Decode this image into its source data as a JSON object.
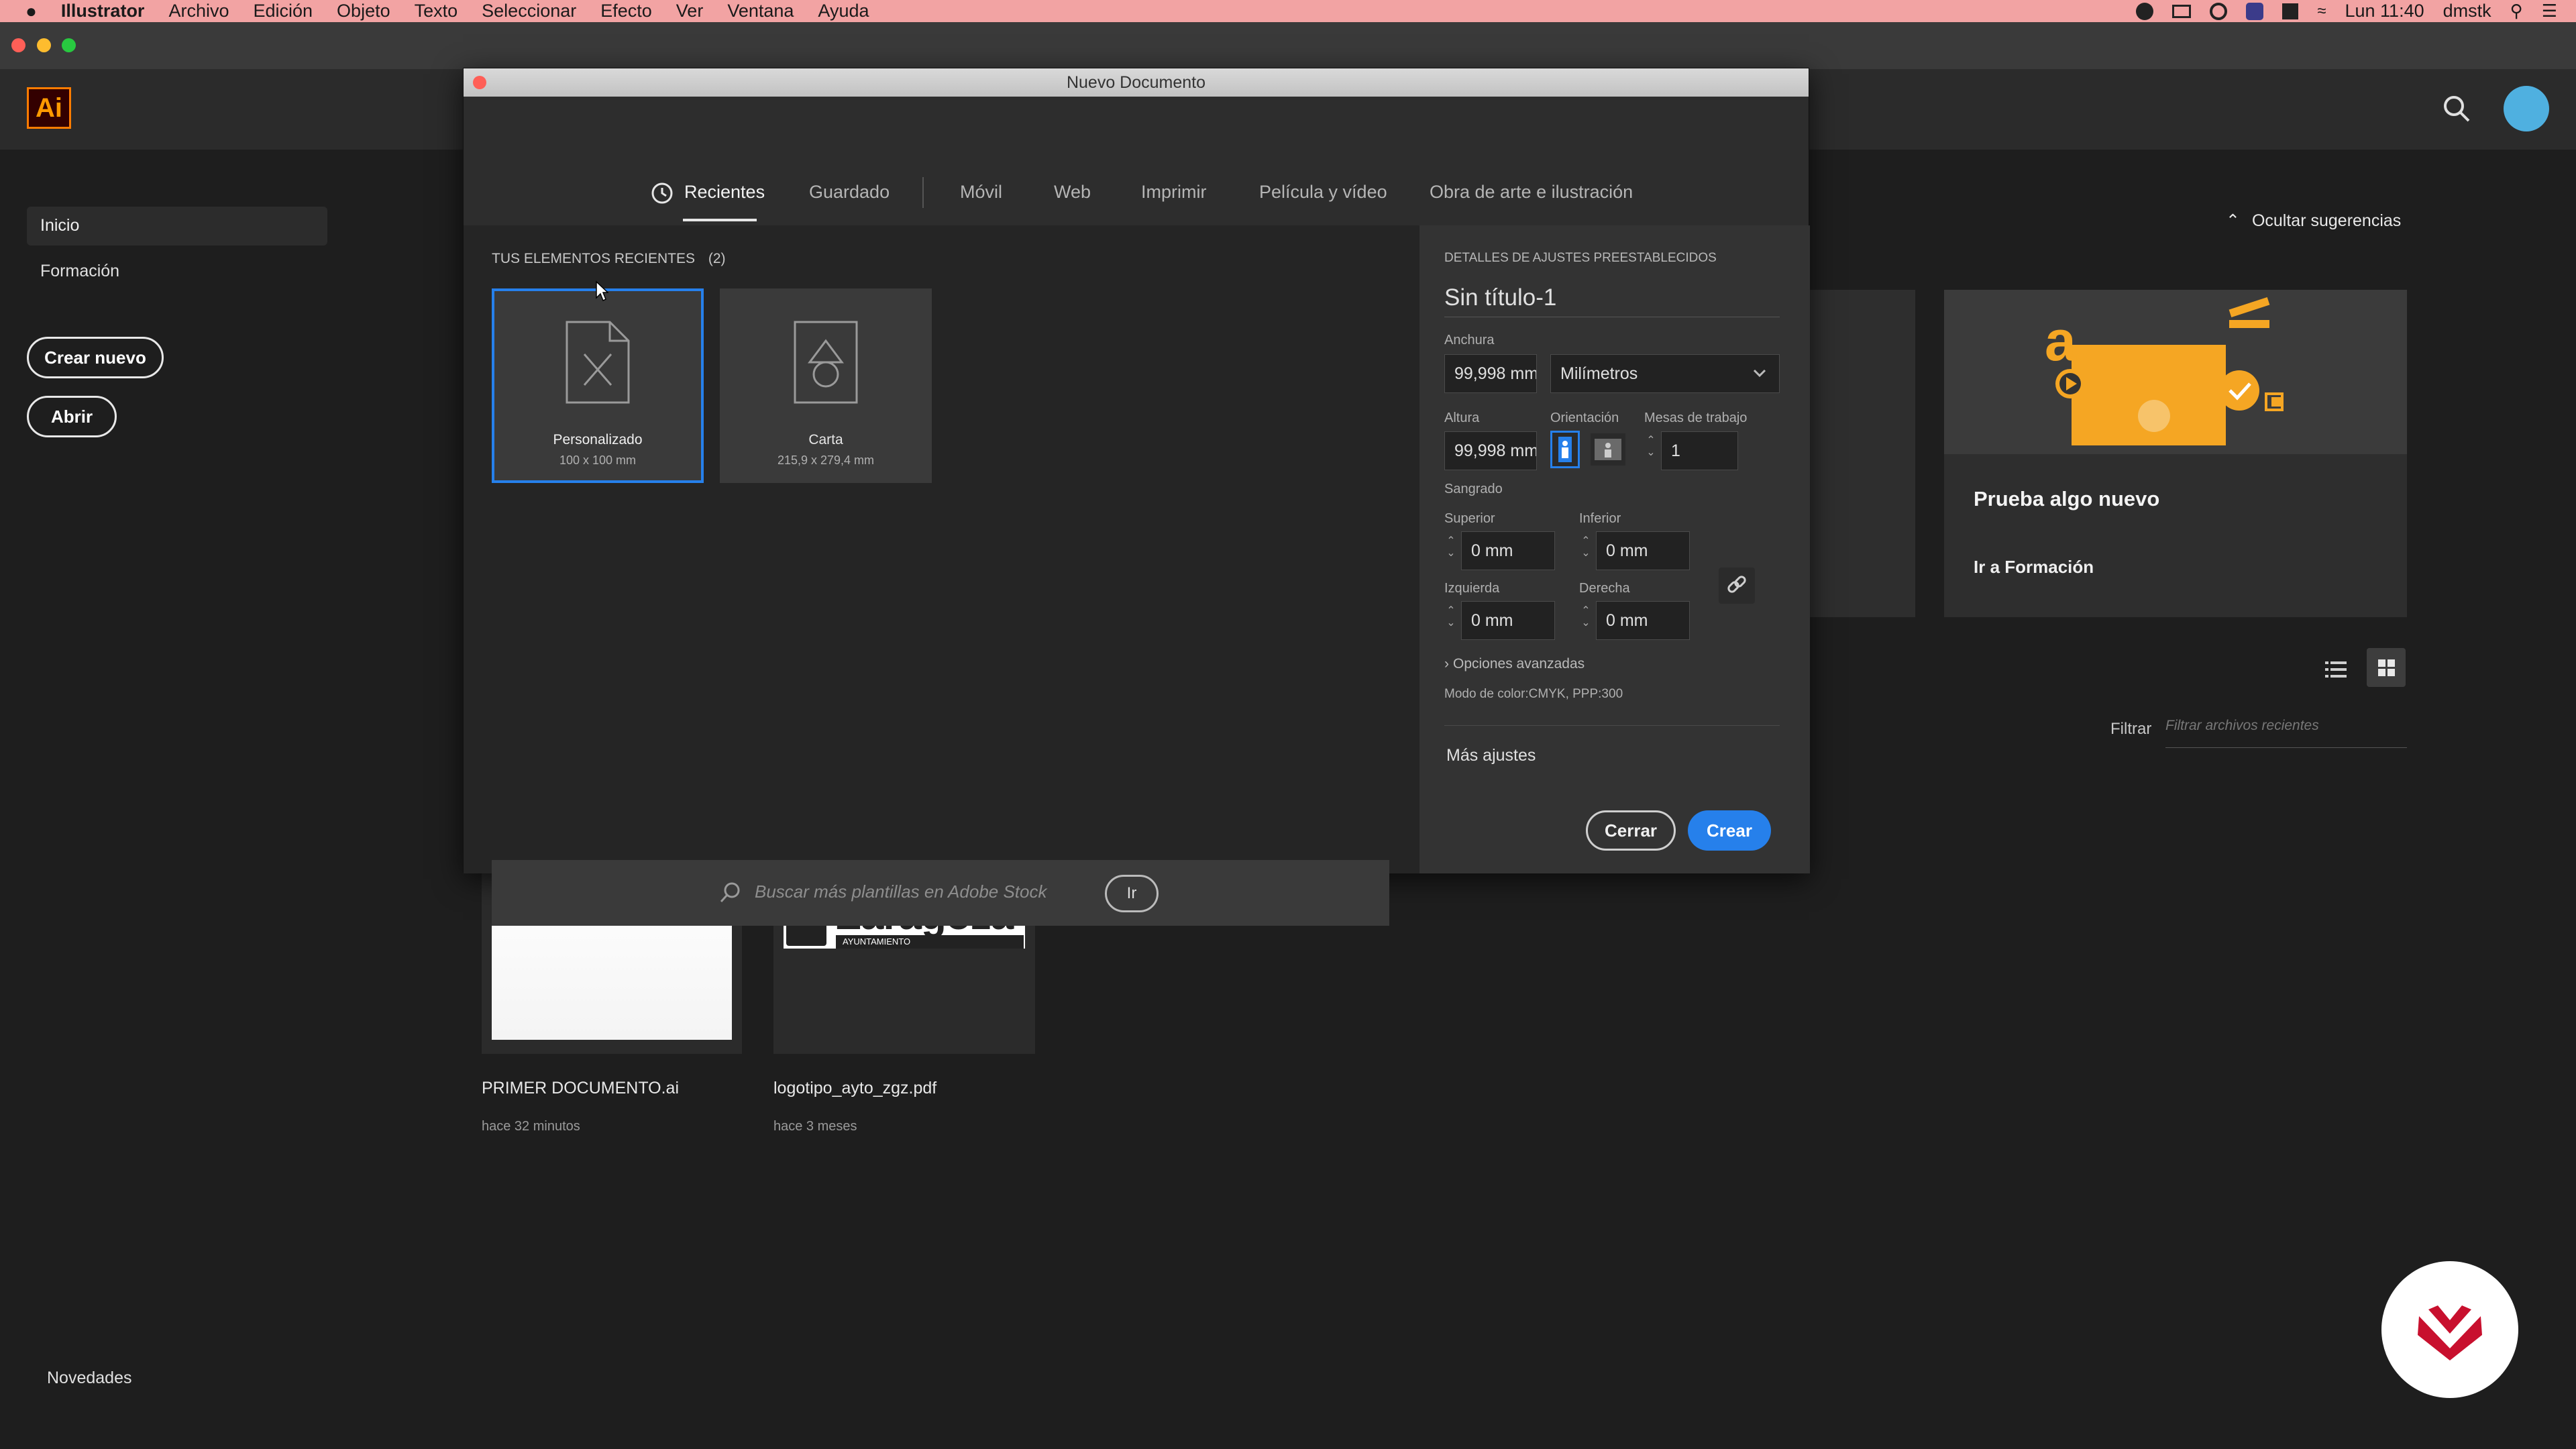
{
  "menubar": {
    "apple": "",
    "app": "Illustrator",
    "items": [
      "Archivo",
      "Edición",
      "Objeto",
      "Texto",
      "Seleccionar",
      "Efecto",
      "Ver",
      "Ventana",
      "Ayuda"
    ],
    "clock": "Lun 11:40",
    "user": "dmstk"
  },
  "app": {
    "logo": "Ai",
    "sidebar": {
      "items": [
        {
          "label": "Inicio"
        },
        {
          "label": "Formación"
        }
      ]
    },
    "buttons": {
      "crear_nuevo": "Crear nuevo",
      "abrir": "Abrir"
    },
    "footer": "Novedades",
    "suggestions": {
      "toggle": "Ocultar sugerencias",
      "card_title": "Prueba algo nuevo",
      "card_link": "Ir a Formación"
    },
    "filter": {
      "label": "Filtrar",
      "placeholder": "Filtrar archivos recientes"
    },
    "recent_files": [
      {
        "name": "PRIMER DOCUMENTO.ai",
        "time": "hace 32 minutos"
      },
      {
        "name": "logotipo_ayto_zgz.pdf",
        "time": "hace 3 meses",
        "thumb_title": "Zaragoza",
        "thumb_sub": "AYUNTAMIENTO"
      }
    ]
  },
  "dialog": {
    "title": "Nuevo Documento",
    "tabs": [
      "Recientes",
      "Guardado",
      "Móvil",
      "Web",
      "Imprimir",
      "Película y vídeo",
      "Obra de arte e ilustración"
    ],
    "recent_heading": "TUS ELEMENTOS RECIENTES",
    "recent_count": "(2)",
    "presets": [
      {
        "name": "Personalizado",
        "size": "100 x 100 mm"
      },
      {
        "name": "Carta",
        "size": "215,9 x 279,4 mm"
      }
    ],
    "search": {
      "placeholder": "Buscar más plantillas en Adobe Stock",
      "go": "Ir"
    },
    "details": {
      "heading": "DETALLES DE AJUSTES PREESTABLECIDOS",
      "name": "Sin título-1",
      "width_label": "Anchura",
      "width_value": "99,998 mm",
      "units": "Milímetros",
      "height_label": "Altura",
      "height_value": "99,998 mm",
      "orientation_label": "Orientación",
      "artboards_label": "Mesas de trabajo",
      "artboards_value": "1",
      "bleed_label": "Sangrado",
      "top_label": "Superior",
      "top_value": "0 mm",
      "bottom_label": "Inferior",
      "bottom_value": "0 mm",
      "left_label": "Izquierda",
      "left_value": "0 mm",
      "right_label": "Derecha",
      "right_value": "0 mm",
      "advanced": "Opciones avanzadas",
      "color_mode": "Modo de color:CMYK, PPP:300",
      "more": "Más ajustes",
      "close": "Cerrar",
      "create": "Crear"
    }
  },
  "colors": {
    "accent": "#2680eb",
    "ai_orange": "#ff9a00",
    "menubar": "#f2a3a3"
  }
}
